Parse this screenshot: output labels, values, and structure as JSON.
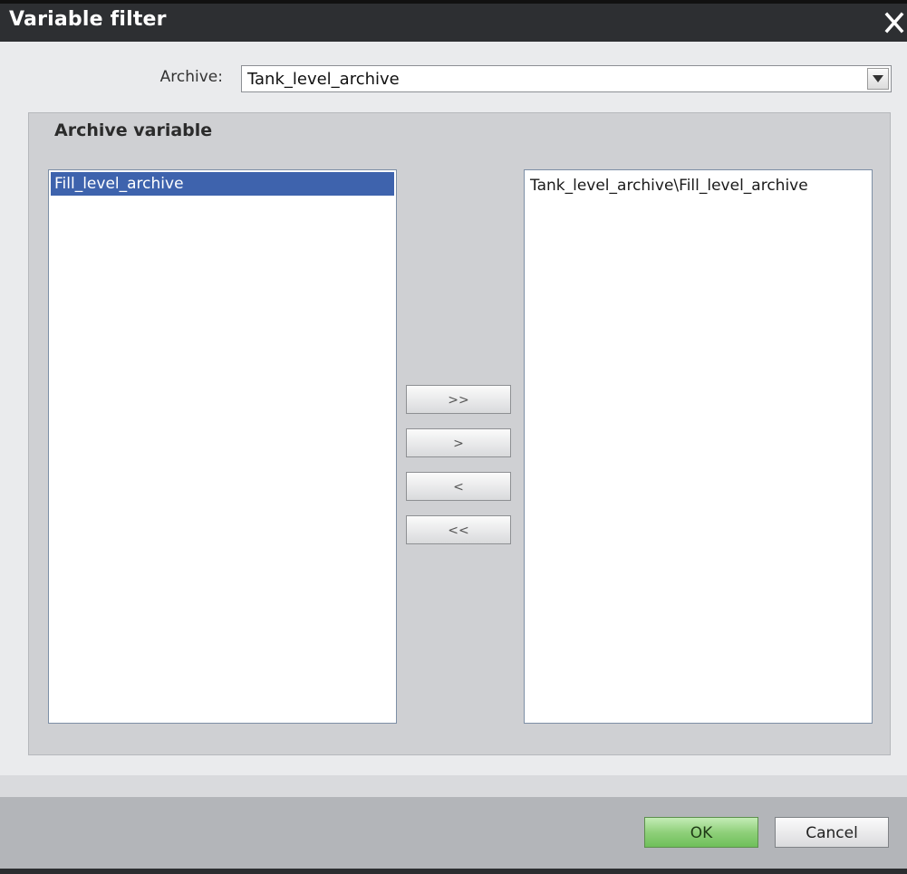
{
  "window": {
    "title": "Variable filter"
  },
  "archive": {
    "label": "Archive:",
    "selected_value": "Tank_level_archive"
  },
  "group": {
    "title": "Archive variable"
  },
  "available_list": {
    "items": [
      "Fill_level_archive"
    ],
    "selected_index": 0
  },
  "selected_list": {
    "items": [
      "Tank_level_archive\\Fill_level_archive"
    ]
  },
  "move_buttons": {
    "add_all": ">>",
    "add_one": ">",
    "remove_one": "<",
    "remove_all": "<<"
  },
  "footer": {
    "ok_label": "OK",
    "cancel_label": "Cancel"
  },
  "colors": {
    "titlebar": "#2d2f32",
    "selection": "#3e63ad",
    "ok_button": "#8fd07a"
  },
  "icons": {
    "close": "close-icon",
    "dropdown": "chevron-down-icon"
  }
}
